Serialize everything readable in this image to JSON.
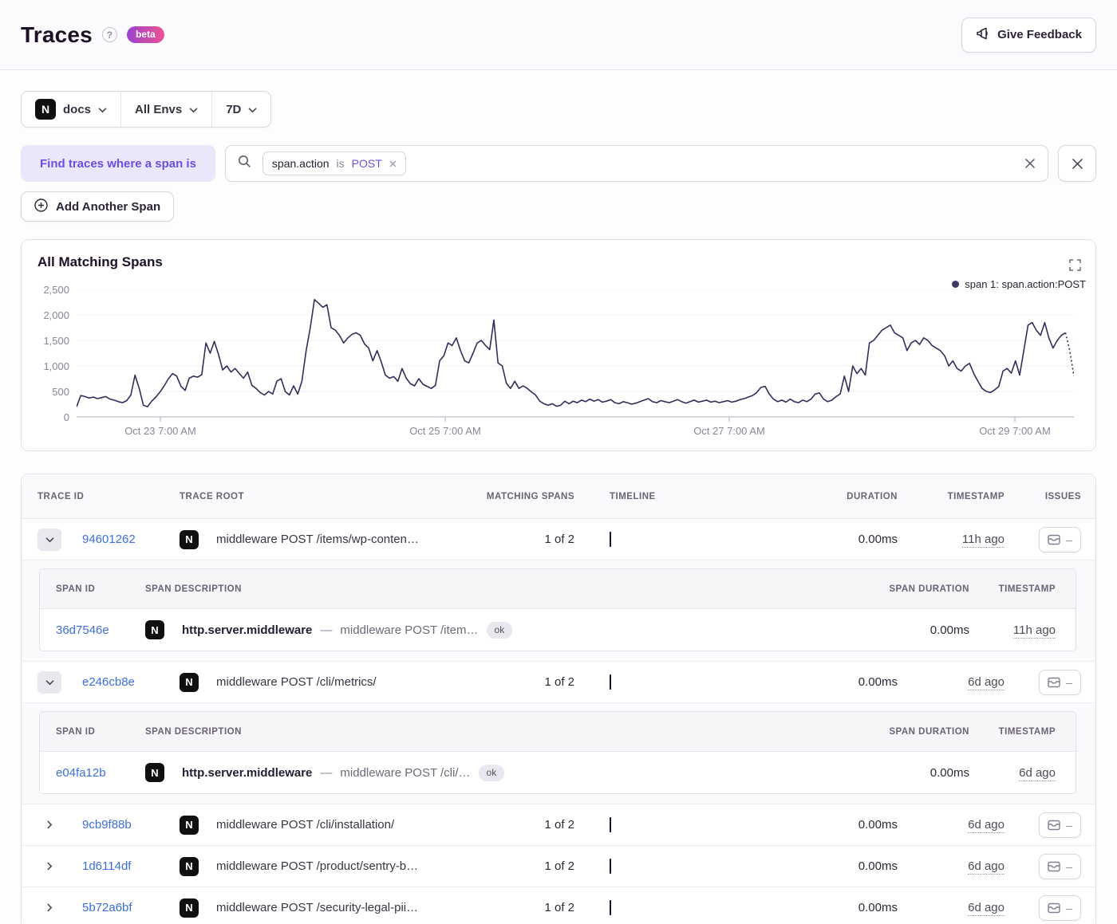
{
  "colors": {
    "accent_purple": "#6a4fe6",
    "filter_value_purple": "#6553dd",
    "link_blue": "#3c6edd",
    "line": "#332d5b",
    "timeline_bar": "#454372",
    "timeline_bar_border": "#16143c",
    "beta_gradient_from": "#9a43cd",
    "beta_gradient_to": "#ee5292"
  },
  "header": {
    "title": "Traces",
    "help": "?",
    "beta_badge": "beta",
    "feedback_label": "Give Feedback"
  },
  "filters": {
    "project_icon_letter": "N",
    "project": "docs",
    "environment": "All Envs",
    "period": "7D"
  },
  "search": {
    "where_label": "Find traces where a span is",
    "chip": {
      "key": "span.action",
      "op": "is",
      "value": "POST"
    },
    "input_value": "",
    "add_span_label": "Add Another Span"
  },
  "chart_data": {
    "type": "line",
    "title": "All Matching Spans",
    "legend": [
      "span 1: span.action:POST"
    ],
    "legend_position": "top-right",
    "grid": true,
    "ylim": [
      0,
      2500
    ],
    "yticks": [
      "2,500",
      "2,000",
      "1,500",
      "1,000",
      "500",
      "0"
    ],
    "xticks": [
      {
        "label": "Oct 23 7:00 AM",
        "f": 0.084
      },
      {
        "label": "Oct 25 7:00 AM",
        "f": 0.3696
      },
      {
        "label": "Oct 27 7:00 AM",
        "f": 0.6544
      },
      {
        "label": "Oct 29 7:00 AM",
        "f": 0.9408
      }
    ],
    "line_color": "#332d5b",
    "values": [
      200,
      420,
      400,
      370,
      390,
      360,
      380,
      400,
      350,
      330,
      300,
      280,
      320,
      430,
      820,
      560,
      230,
      200,
      310,
      390,
      490,
      610,
      750,
      850,
      800,
      600,
      520,
      760,
      800,
      780,
      830,
      1450,
      1250,
      1480,
      1230,
      920,
      1000,
      880,
      950,
      850,
      760,
      880,
      620,
      560,
      480,
      430,
      500,
      450,
      700,
      750,
      500,
      430,
      610,
      450,
      700,
      1300,
      1750,
      2300,
      2230,
      2150,
      2200,
      1750,
      1700,
      1600,
      1450,
      1550,
      1620,
      1650,
      1600,
      1430,
      1350,
      1100,
      1300,
      1080,
      820,
      760,
      790,
      700,
      950,
      760,
      650,
      610,
      750,
      640,
      600,
      560,
      620,
      1100,
      1200,
      1450,
      1400,
      1550,
      1300,
      1100,
      1060,
      1250,
      1450,
      1500,
      1400,
      1320,
      1900,
      1060,
      1000,
      660,
      560,
      700,
      560,
      610,
      560,
      490,
      430,
      310,
      260,
      230,
      260,
      210,
      230,
      310,
      260,
      310,
      280,
      330,
      300,
      350,
      310,
      340,
      290,
      310,
      340,
      280,
      260,
      300,
      280,
      250,
      270,
      300,
      330,
      360,
      300,
      280,
      320,
      300,
      280,
      310,
      340,
      300,
      270,
      300,
      330,
      290,
      310,
      330,
      290,
      310,
      280,
      300,
      320,
      290,
      310,
      340,
      360,
      390,
      420,
      480,
      580,
      600,
      450,
      350,
      300,
      330,
      290,
      350,
      300,
      280,
      330,
      300,
      350,
      450,
      470,
      350,
      300,
      330,
      400,
      450,
      800,
      500,
      1000,
      850,
      950,
      820,
      1450,
      1500,
      1600,
      1700,
      1750,
      1800,
      1650,
      1600,
      1550,
      1300,
      1450,
      1500,
      1420,
      1550,
      1500,
      1400,
      1350,
      1300,
      1200,
      1000,
      1100,
      950,
      900,
      1000,
      1050,
      850,
      700,
      560,
      500,
      480,
      530,
      600,
      900,
      950,
      860,
      1100,
      820,
      1300,
      1800,
      1850,
      1700,
      1600,
      1850,
      1550,
      1350,
      1500,
      1600,
      1650,
      1300,
      800
    ]
  },
  "table": {
    "headers": {
      "trace_id": "TRACE ID",
      "trace_root": "TRACE ROOT",
      "matching_spans": "MATCHING SPANS",
      "timeline": "TIMELINE",
      "duration": "DURATION",
      "timestamp": "TIMESTAMP",
      "issues": "ISSUES"
    },
    "sub_headers": {
      "span_id": "SPAN ID",
      "span_description": "SPAN DESCRIPTION",
      "span_duration": "SPAN DURATION",
      "timestamp": "TIMESTAMP"
    },
    "separator": "—",
    "issues_dash": "–",
    "project_icon_letter": "N",
    "rows": [
      {
        "id": "94601262",
        "root": "middleware POST /items/wp-conten…",
        "matching": "1 of 2",
        "duration": "0.00ms",
        "timestamp": "11h ago",
        "expanded": true,
        "span": {
          "id": "36d7546e",
          "op": "http.server.middleware",
          "desc": "middleware POST /item…",
          "status": "ok",
          "duration": "0.00ms",
          "timestamp": "11h ago"
        }
      },
      {
        "id": "e246cb8e",
        "root": "middleware POST /cli/metrics/",
        "matching": "1 of 2",
        "duration": "0.00ms",
        "timestamp": "6d ago",
        "expanded": true,
        "span": {
          "id": "e04fa12b",
          "op": "http.server.middleware",
          "desc": "middleware POST /cli/…",
          "status": "ok",
          "duration": "0.00ms",
          "timestamp": "6d ago"
        }
      },
      {
        "id": "9cb9f88b",
        "root": "middleware POST /cli/installation/",
        "matching": "1 of 2",
        "duration": "0.00ms",
        "timestamp": "6d ago",
        "expanded": false
      },
      {
        "id": "1d6114df",
        "root": "middleware POST /product/sentry-b…",
        "matching": "1 of 2",
        "duration": "0.00ms",
        "timestamp": "6d ago",
        "expanded": false
      },
      {
        "id": "5b72a6bf",
        "root": "middleware POST /security-legal-pii…",
        "matching": "1 of 2",
        "duration": "0.00ms",
        "timestamp": "6d ago",
        "expanded": false
      }
    ]
  }
}
